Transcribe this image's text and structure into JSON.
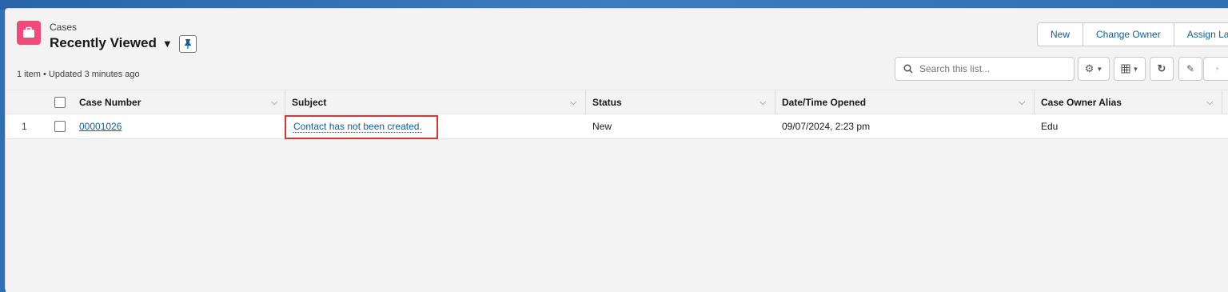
{
  "header": {
    "object_label": "Cases",
    "list_view_name": "Recently Viewed",
    "meta": "1 item • Updated 3 minutes ago"
  },
  "actions": {
    "new_label": "New",
    "change_owner_label": "Change Owner",
    "assign_label": "Assign Lab"
  },
  "search": {
    "placeholder": "Search this list..."
  },
  "icons": {
    "object": "briefcase-icon",
    "pin": "pin-icon",
    "search": "search-icon",
    "settings": "gear-icon",
    "display": "table-icon",
    "refresh": "refresh-icon",
    "edit": "pencil-icon",
    "chart": "chart-icon"
  },
  "table": {
    "columns": [
      "Case Number",
      "Subject",
      "Status",
      "Date/Time Opened",
      "Case Owner Alias"
    ],
    "rows": [
      {
        "index": "1",
        "case_number": "00001026",
        "subject": "Contact has not been created.",
        "status": "New",
        "opened": "09/07/2024, 2:23 pm",
        "owner": "Edu"
      }
    ]
  },
  "colors": {
    "brand_bg": "#2f6fb5",
    "case_icon": "#f1497b",
    "link": "#0b5cab",
    "highlight": "#e03030"
  }
}
